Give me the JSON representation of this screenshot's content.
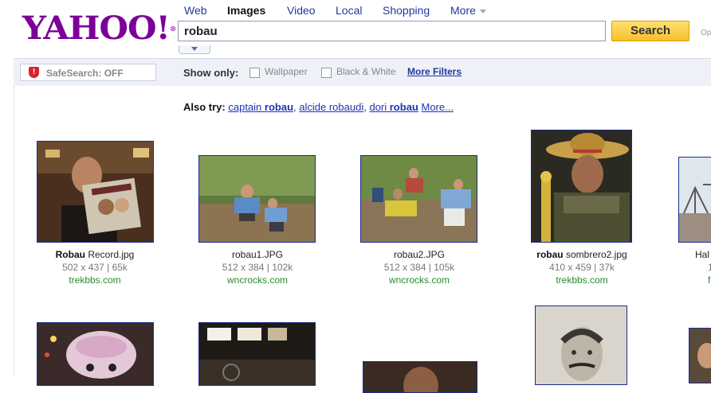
{
  "header": {
    "logo_text": "YAHOO!",
    "logo_mark": "®",
    "nav": [
      "Web",
      "Images",
      "Video",
      "Local",
      "Shopping",
      "More"
    ],
    "active_nav": "Images",
    "query": "robau",
    "search_button": "Search",
    "options_link": "Op"
  },
  "filters": {
    "safesearch": "SafeSearch: OFF",
    "show_only": "Show only:",
    "wallpaper": "Wallpaper",
    "black_white": "Black & White",
    "more_filters": "More Filters"
  },
  "also_try": {
    "label": "Also try:",
    "s1_prefix": "captain ",
    "s1_bold": "robau",
    "s2": "alcide robaudi",
    "s3_prefix": "dori ",
    "s3_bold": "robau",
    "more": "More..."
  },
  "results": [
    {
      "title_bold": "Robau",
      "title_rest": " Record.jpg",
      "meta": "502 x 437 | 65k",
      "site": "trekbbs.com"
    },
    {
      "title_bold": "",
      "title_rest": "robau1.JPG",
      "meta": "512 x 384 | 102k",
      "site": "wncrocks.com"
    },
    {
      "title_bold": "",
      "title_rest": "robau2.JPG",
      "meta": "512 x 384 | 105k",
      "site": "wncrocks.com"
    },
    {
      "title_bold": "robau",
      "title_rest": " sombrero2.jpg",
      "meta": "410 x 459 | 37k",
      "site": "trekbbs.com"
    },
    {
      "title_bold": "",
      "title_rest": "Hal",
      "meta": "1",
      "site": "f"
    }
  ],
  "colors": {
    "brand": "#7b0099",
    "search_button": "#f7bf2d",
    "link": "#1a34b8",
    "site_green": "#2a8a2a",
    "thumb_border": "#1c2d8f"
  }
}
